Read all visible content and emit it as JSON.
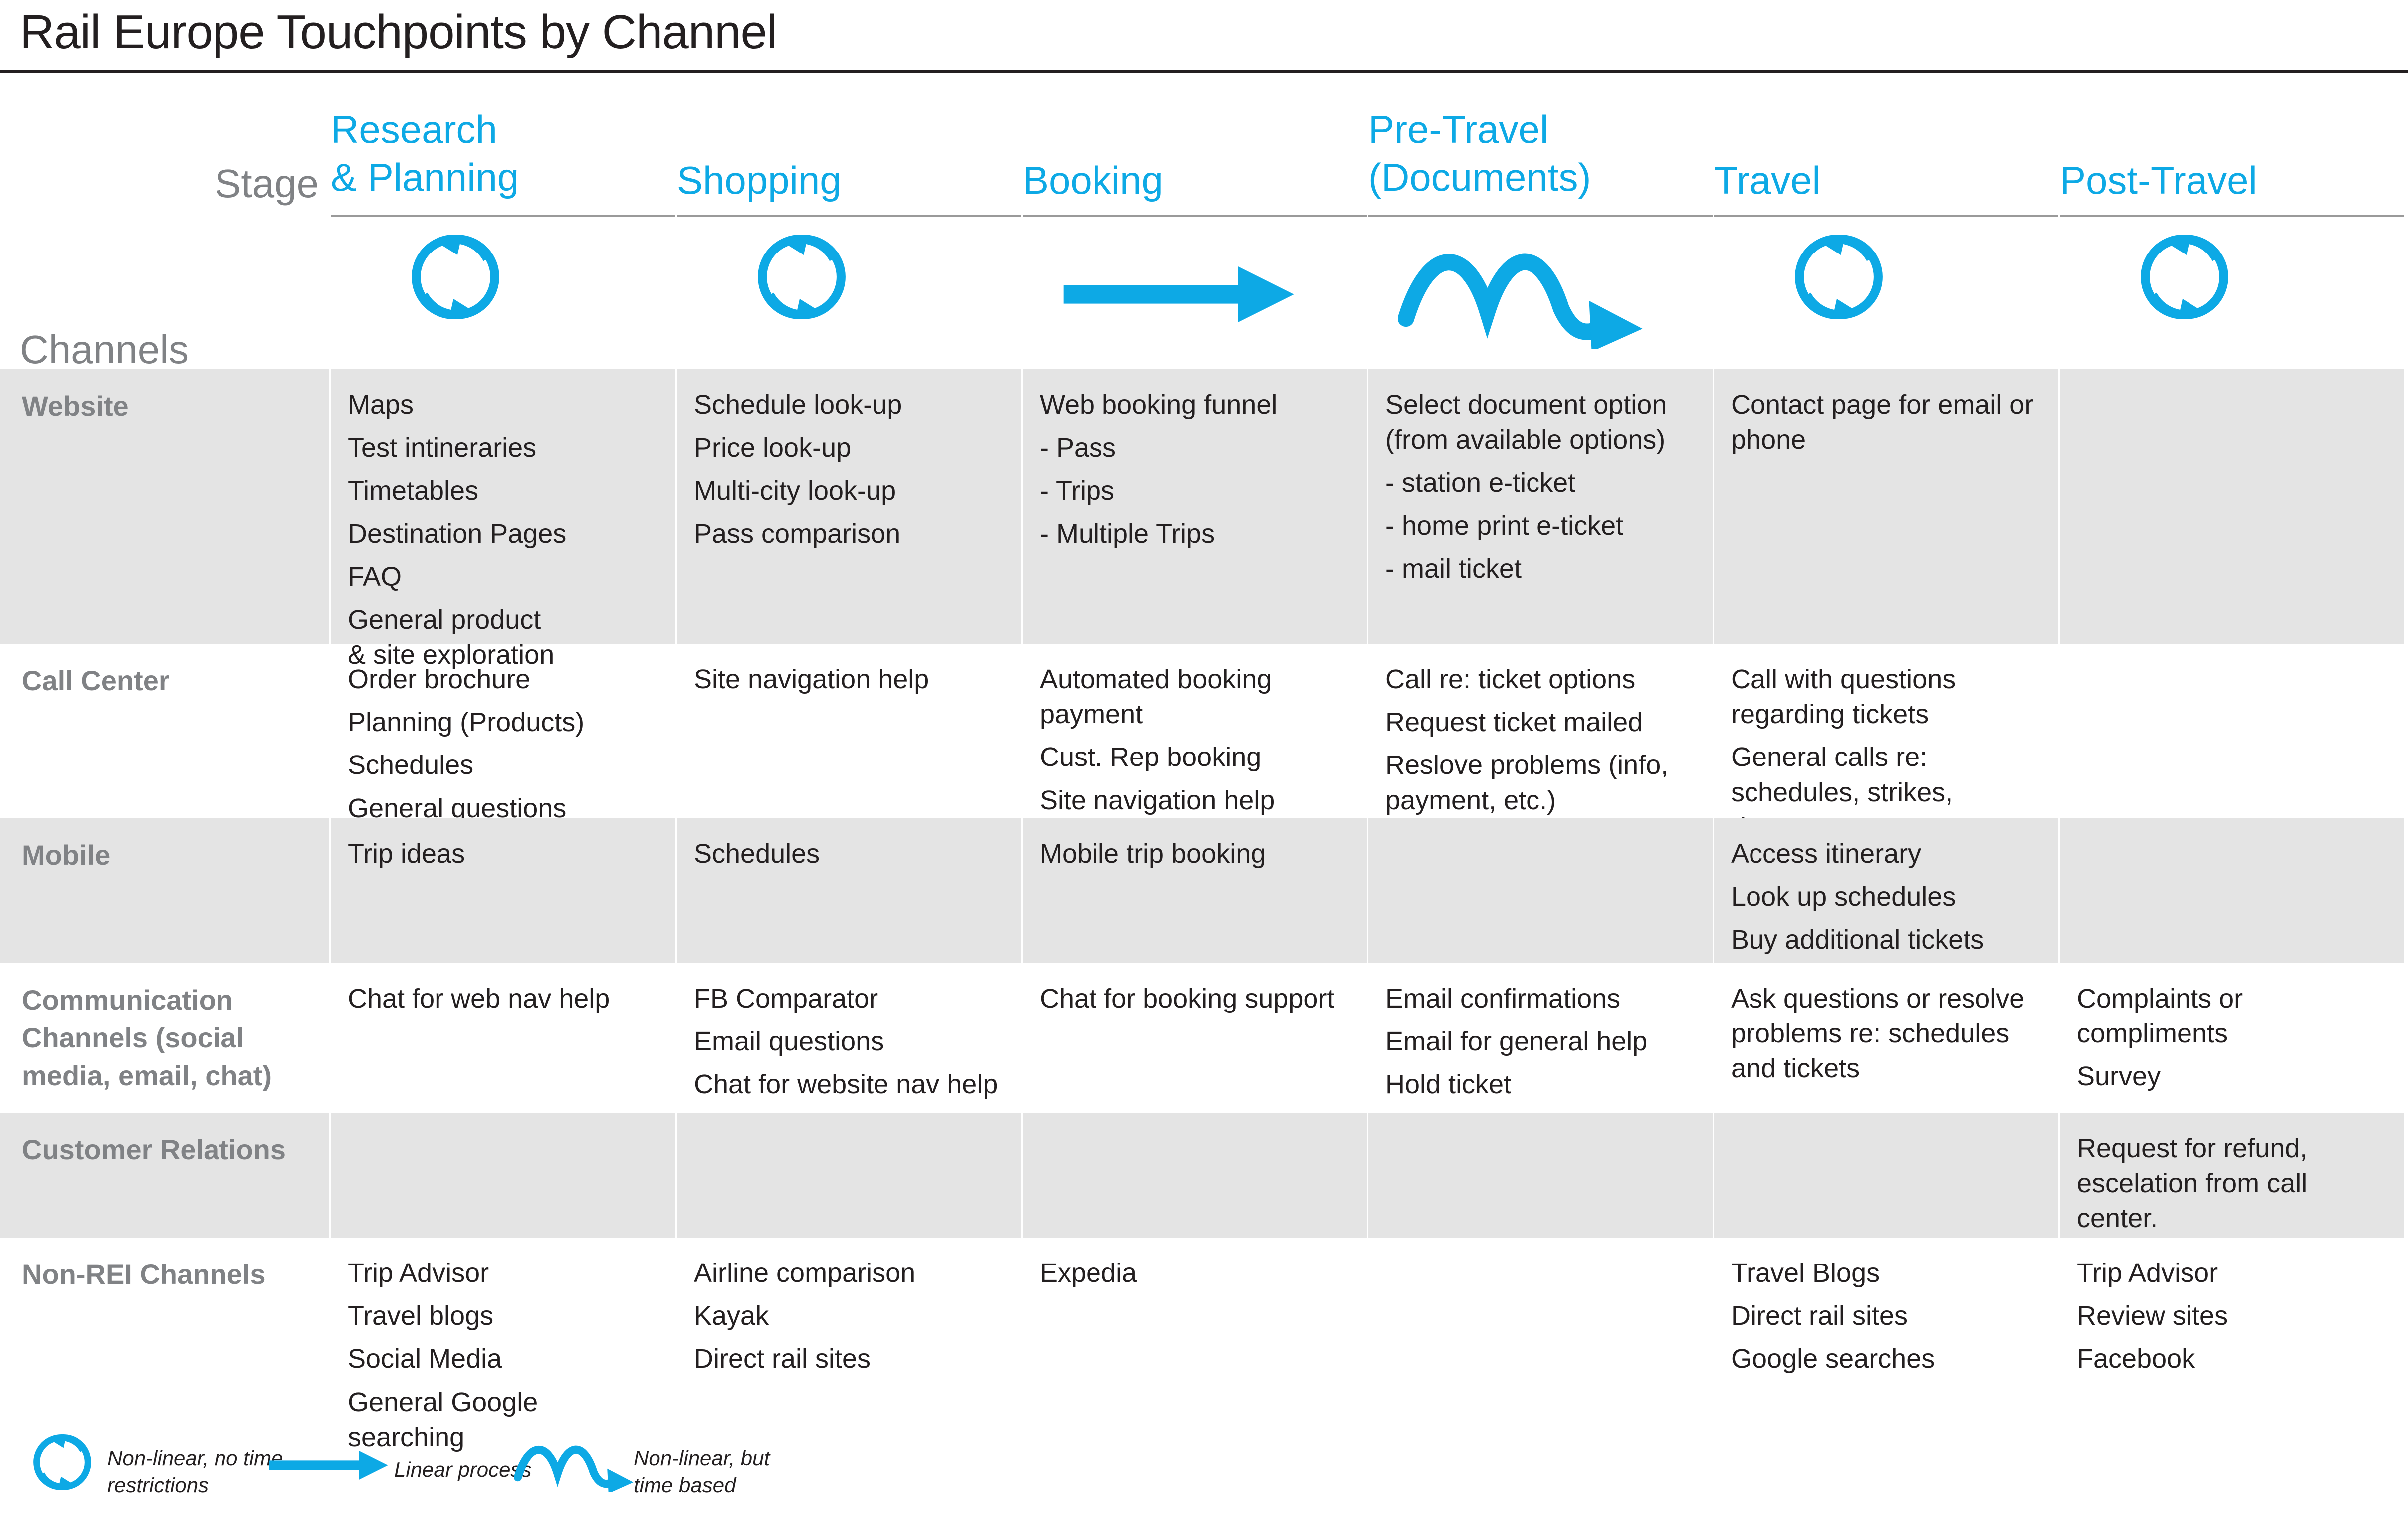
{
  "title": "Rail Europe Touchpoints by Channel",
  "axis_labels": {
    "stage": "Stage",
    "channels": "Channels"
  },
  "accent_color": "#0DA9E5",
  "shade_color": "#E4E4E4",
  "label_color": "#808285",
  "stages": [
    {
      "line1": "Research",
      "line2": "& Planning",
      "icon": "circular-arrow-icon"
    },
    {
      "line1": "Shopping",
      "line2": "",
      "icon": "circular-arrow-icon"
    },
    {
      "line1": "Booking",
      "line2": "",
      "icon": "straight-arrow-icon"
    },
    {
      "line1": "Pre-Travel",
      "line2": "(Documents)",
      "icon": "wavy-arrow-icon"
    },
    {
      "line1": "Travel",
      "line2": "",
      "icon": "circular-arrow-icon"
    },
    {
      "line1": "Post-Travel",
      "line2": "",
      "icon": "circular-arrow-icon"
    }
  ],
  "rows": [
    {
      "label": "Website",
      "shaded": true,
      "cells": [
        [
          "Maps",
          "Test intineraries",
          "Timetables",
          "Destination Pages",
          "FAQ",
          "General product\n& site exploration"
        ],
        [
          "Schedule look-up",
          "Price look-up",
          "Multi-city look-up",
          "Pass comparison"
        ],
        [
          "Web booking funnel",
          "- Pass",
          "- Trips",
          "- Multiple Trips"
        ],
        [
          "Select document option (from available options)",
          "- station e-ticket",
          "- home print e-ticket",
          "- mail ticket"
        ],
        [
          "Contact page for email or phone"
        ],
        []
      ]
    },
    {
      "label": "Call Center",
      "shaded": false,
      "cells": [
        [
          "Order brochure",
          "Planning (Products)",
          "Schedules",
          "General questions"
        ],
        [
          "Site navigation help"
        ],
        [
          "Automated booking payment",
          "Cust. Rep booking",
          "Site navigation help"
        ],
        [
          "Call re: ticket options",
          "Request ticket mailed",
          "Reslove problems (info, payment, etc.)"
        ],
        [
          "Call with questions regarding tickets",
          "General calls re: schedules, strikes, documents"
        ],
        []
      ]
    },
    {
      "label": "Mobile",
      "shaded": true,
      "cells": [
        [
          "Trip ideas"
        ],
        [
          "Schedules"
        ],
        [
          "Mobile trip booking"
        ],
        [],
        [
          "Access itinerary",
          "Look up schedules",
          "Buy additional tickets"
        ],
        []
      ]
    },
    {
      "label": "Communication Channels (social media, email, chat)",
      "shaded": false,
      "cells": [
        [
          "Chat for web nav help"
        ],
        [
          "FB Comparator",
          "Email questions",
          "Chat for website nav help"
        ],
        [
          "Chat for booking support"
        ],
        [
          "Email confirmations",
          "Email for general help",
          "Hold ticket"
        ],
        [
          "Ask questions or resolve problems re: schedules and tickets"
        ],
        [
          "Complaints or compliments",
          "Survey"
        ]
      ]
    },
    {
      "label": "Customer Relations",
      "shaded": true,
      "cells": [
        [],
        [],
        [],
        [],
        [],
        [
          "Request for refund, escelation from call center."
        ]
      ]
    },
    {
      "label": "Non-REI Channels",
      "shaded": false,
      "cells": [
        [
          "Trip Advisor",
          "Travel blogs",
          "Social Media",
          "General Google\nsearching"
        ],
        [
          "Airline comparison",
          "Kayak",
          "Direct rail sites"
        ],
        [
          "Expedia"
        ],
        [],
        [
          "Travel Blogs",
          "Direct rail sites",
          "Google searches"
        ],
        [
          "Trip Advisor",
          "Review sites",
          "Facebook"
        ]
      ]
    }
  ],
  "legend": [
    {
      "icon": "circular-arrow-icon",
      "line1": "Non-linear, no time",
      "line2": "restrictions"
    },
    {
      "icon": "straight-arrow-icon",
      "line1": "Linear process",
      "line2": ""
    },
    {
      "icon": "wavy-arrow-icon",
      "line1": "Non-linear, but",
      "line2": "time based"
    }
  ]
}
